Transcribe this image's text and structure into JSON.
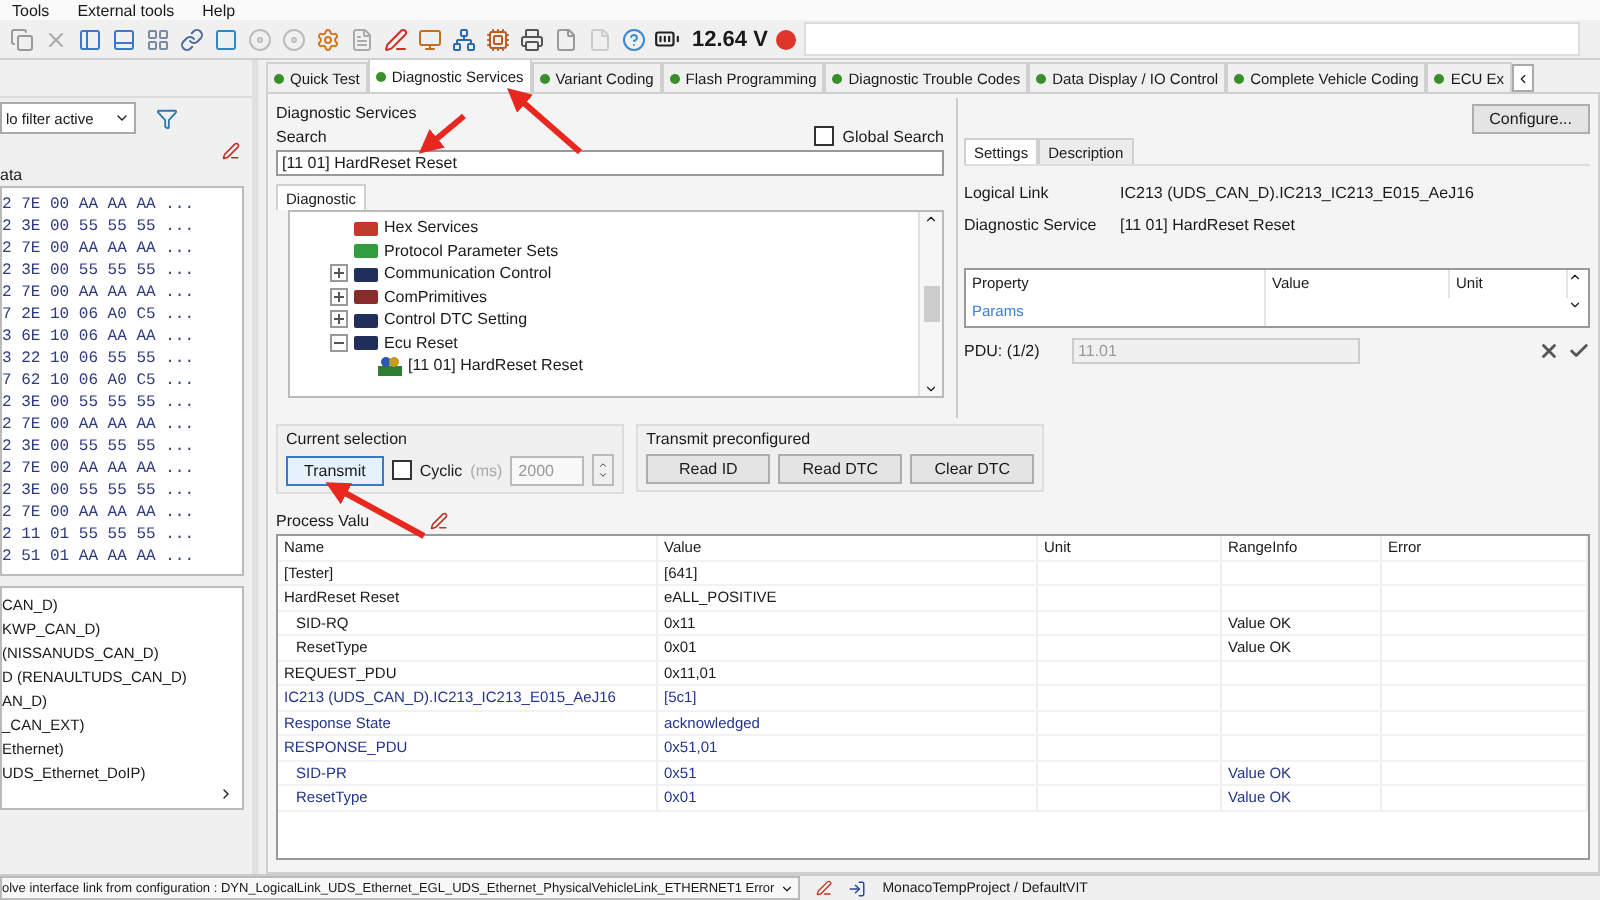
{
  "menu": [
    "Tools",
    "External tools",
    "Help"
  ],
  "toolbar": {
    "voltage": "12.64 V"
  },
  "left_panel": {
    "filter": "lo filter active",
    "data_header": "ata",
    "hex_rows": [
      "2 7E 00 AA AA AA ...",
      "2 3E 00 55 55 55 ...",
      "2 7E 00 AA AA AA ...",
      "2 3E 00 55 55 55 ...",
      "2 7E 00 AA AA AA ...",
      "7 2E 10 06 A0 C5 ...",
      "3 6E 10 06 AA AA ...",
      "3 22 10 06 55 55 ...",
      "7 62 10 06 A0 C5 ...",
      "2 3E 00 55 55 55 ...",
      "2 7E 00 AA AA AA ...",
      "2 3E 00 55 55 55 ...",
      "2 7E 00 AA AA AA ...",
      "2 3E 00 55 55 55 ...",
      "2 7E 00 AA AA AA ...",
      "2 11 01 55 55 55 ...",
      "2 51 01 AA AA AA ..."
    ],
    "links": [
      "CAN_D)",
      "KWP_CAN_D)",
      "(NISSANUDS_CAN_D)",
      "D (RENAULTUDS_CAN_D)",
      "AN_D)",
      "_CAN_EXT)",
      "Ethernet)",
      "UDS_Ethernet_DoIP)"
    ]
  },
  "tabs": [
    {
      "label": "Quick Test",
      "selected": false
    },
    {
      "label": "Diagnostic Services",
      "selected": true
    },
    {
      "label": "Variant Coding",
      "selected": false
    },
    {
      "label": "Flash Programming",
      "selected": false
    },
    {
      "label": "Diagnostic Trouble Codes",
      "selected": false
    },
    {
      "label": "Data Display / IO Control",
      "selected": false
    },
    {
      "label": "Complete Vehicle Coding",
      "selected": false
    },
    {
      "label": "ECU Ex",
      "selected": false
    }
  ],
  "diagnostic_services": {
    "title": "Diagnostic Services",
    "search_label": "Search",
    "global_search": {
      "label": "Global Search",
      "checked": false
    },
    "search_value": "[11 01] HardReset Reset",
    "tree_tab": "Diagnostic",
    "tree": [
      {
        "kind": "folder",
        "label": "Hex Services",
        "color": "#c0392b"
      },
      {
        "kind": "folder",
        "label": "Protocol Parameter Sets",
        "color": "#2e9e3e"
      },
      {
        "kind": "folder",
        "label": "Communication Control",
        "color": "#1f2f5a",
        "expanded": false
      },
      {
        "kind": "folder",
        "label": "ComPrimitives",
        "color": "#8a2a2a",
        "expanded": false
      },
      {
        "kind": "folder",
        "label": "Control DTC Setting",
        "color": "#1f2f5a",
        "expanded": false
      },
      {
        "kind": "folder",
        "label": "Ecu Reset",
        "color": "#1f2f5a",
        "expanded": true,
        "children": [
          {
            "kind": "service",
            "label": "[11 01] HardReset Reset"
          }
        ]
      }
    ]
  },
  "settings": {
    "configure": "Configure...",
    "tabs": [
      {
        "label": "Settings",
        "selected": true
      },
      {
        "label": "Description",
        "selected": false
      }
    ],
    "fields": [
      {
        "label": "Logical Link",
        "value": "IC213 (UDS_CAN_D).IC213_IC213_E015_AeJ16"
      },
      {
        "label": "Diagnostic Service",
        "value": "[11 01] HardReset Reset"
      }
    ],
    "property_columns": [
      "Property",
      "Value",
      "Unit"
    ],
    "property_rows": [
      {
        "property": "Params"
      }
    ],
    "pdu_label": "PDU: (1/2)",
    "pdu_value": "11.01"
  },
  "current_selection": {
    "title": "Current selection",
    "transmit": "Transmit",
    "cyclic": {
      "label": "Cyclic",
      "checked": false
    },
    "unit": "(ms)",
    "interval": "2000"
  },
  "transmit_preconfigured": {
    "title": "Transmit preconfigured",
    "buttons": [
      "Read ID",
      "Read DTC",
      "Clear DTC"
    ]
  },
  "process_values": {
    "title": "Process Valu",
    "columns": [
      "Name",
      "Value",
      "Unit",
      "RangeInfo",
      "Error"
    ],
    "rows": [
      {
        "kind": "request",
        "name": "[Tester]",
        "value": "[641]"
      },
      {
        "kind": "request",
        "name": "HardReset Reset",
        "value": "eALL_POSITIVE",
        "children": [
          {
            "kind": "request",
            "name": "SID-RQ",
            "value": "0x11",
            "range_info": "Value OK"
          },
          {
            "kind": "request",
            "name": "ResetType",
            "value": "0x01",
            "range_info": "Value OK"
          }
        ]
      },
      {
        "kind": "request",
        "name": "REQUEST_PDU",
        "value": "0x11,01"
      },
      {
        "kind": "response",
        "name": "IC213 (UDS_CAN_D).IC213_IC213_E015_AeJ16",
        "value": "[5c1]"
      },
      {
        "kind": "response",
        "name": "Response State",
        "value": "acknowledged"
      },
      {
        "kind": "response",
        "name": "RESPONSE_PDU",
        "value": "0x51,01",
        "children": [
          {
            "kind": "response",
            "name": "SID-PR",
            "value": "0x51",
            "range_info": "Value OK"
          },
          {
            "kind": "response",
            "name": "ResetType",
            "value": "0x01",
            "range_info": "Value OK"
          }
        ]
      }
    ]
  },
  "status_bar": {
    "message": "olve interface link from configuration : DYN_LogicalLink_UDS_Ethernet_EGL_UDS_Ethernet_PhysicalVehicleLink_ETHERNET1 Error",
    "project": "MonacoTempProject / DefaultVIT"
  }
}
